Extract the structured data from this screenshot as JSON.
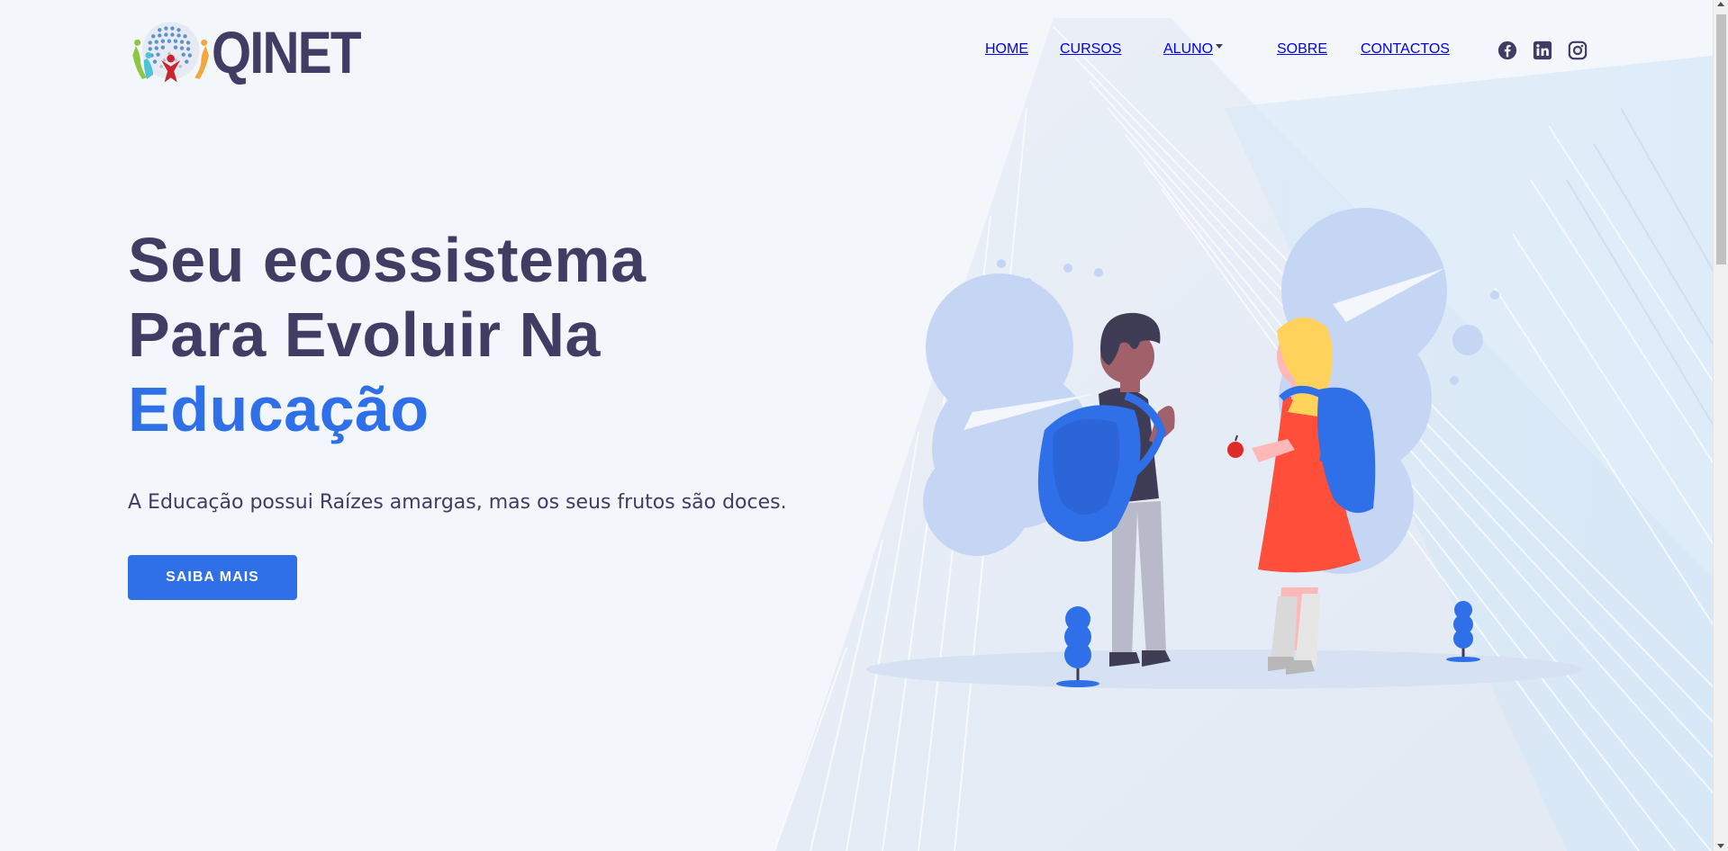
{
  "brand": {
    "name": "QINET"
  },
  "nav": {
    "items": [
      {
        "label": "HOME",
        "active": true
      },
      {
        "label": "CURSOS",
        "active": false
      },
      {
        "label": "ALUNO",
        "active": false,
        "dropdown": true
      },
      {
        "label": "SOBRE",
        "active": false
      },
      {
        "label": "CONTACTOS",
        "active": false
      }
    ],
    "social": [
      "facebook-icon",
      "linkedin-icon",
      "instagram-icon"
    ]
  },
  "hero": {
    "line1": "Seu ecossistema",
    "line2": "Para Evoluir Na",
    "highlight": "Educação",
    "subtitle": "A Educação possui Raízes amargas, mas os seus frutos são doces.",
    "cta_label": "SAIBA MAIS"
  },
  "colors": {
    "accent": "#2f6fe8",
    "text": "#3f3d63",
    "background": "#f3f6fb"
  }
}
